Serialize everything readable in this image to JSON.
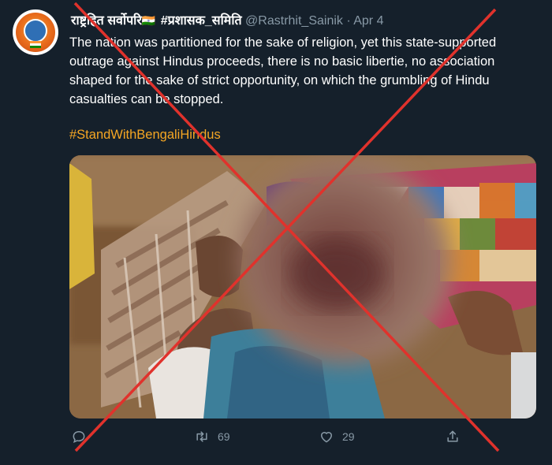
{
  "tweet": {
    "display_name": "राष्ट्रहित सर्वोपरि",
    "flag_glyph": "🇮🇳",
    "group_tag": "#प्रशासक_समिति",
    "handle": "@Rastrhit_Sainik",
    "separator": "·",
    "date": "Apr 4",
    "text": "The nation was partitioned for the sake of religion, yet this state-supported outrage against Hindus proceeds, there is no basic libertie, no association shaped for the sake of strict opportunity, on which the grumbling of Hindu casualties can be stopped.",
    "hashtag": "#StandWithBengaliHindus",
    "media_description": "photo",
    "actions": {
      "reply_count": "",
      "retweet_count": "69",
      "like_count": "29"
    }
  },
  "colors": {
    "background": "#15202b",
    "text": "#ffffff",
    "muted": "#8899a6",
    "hashtag": "#f5a623",
    "cross": "#e0322c"
  }
}
